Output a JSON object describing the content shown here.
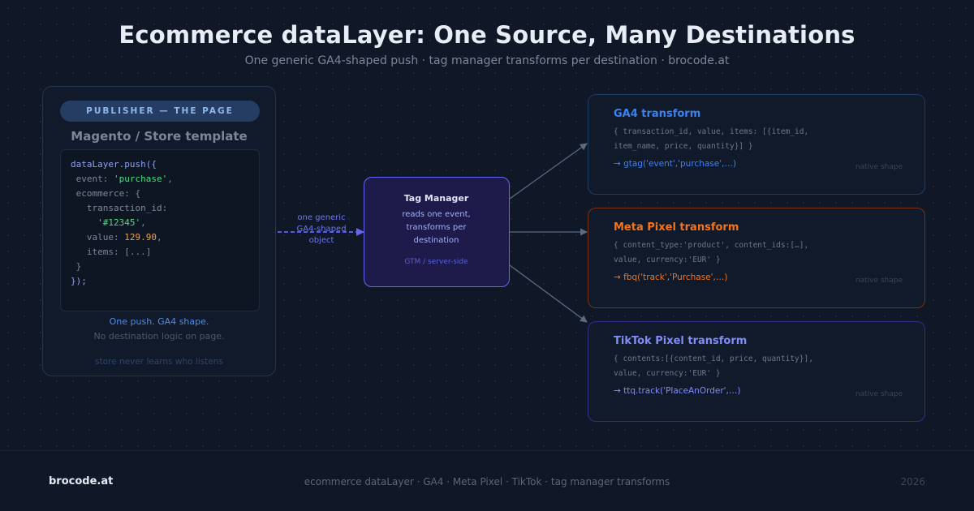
{
  "title": "Ecommerce dataLayer: One Source, Many Destinations",
  "subtitle": "One generic GA4-shaped push · tag manager transforms per destination · brocode.at",
  "publisher": {
    "badge": "PUBLISHER — THE PAGE",
    "subtitle": "Magento / Store template",
    "code": {
      "l1": "dataLayer.push({",
      "l2_key": " event: ",
      "l2_val": "'purchase'",
      "l2_end": ",",
      "l3": " ecommerce: {",
      "l4": "   transaction_id:",
      "l5_pad": "     ",
      "l5_val": "'#12345'",
      "l5_end": ",",
      "l6_key": "   value: ",
      "l6_val": "129.90",
      "l6_end": ",",
      "l7": "   items: [...]",
      "l8": " }",
      "l9": "});"
    },
    "note1": "One push. GA4 shape.",
    "note2": "No destination logic on page.",
    "note3": "store never learns who listens"
  },
  "connector": {
    "line1": "one generic",
    "line2": "GA4-shaped",
    "line3": "object"
  },
  "tag_manager": {
    "title": "Tag Manager",
    "line1": "reads one event,",
    "line2": "transforms per",
    "line3": "destination",
    "footer": "GTM / server-side"
  },
  "destinations": [
    {
      "title": "GA4 transform",
      "code1": "{ transaction_id, value, items: [{item_id,",
      "code2": "item_name, price, quantity}] }",
      "call": "→ gtag('event','purchase',…)",
      "native": "native shape",
      "color": "#3b82f6",
      "border": "#1e3a5f"
    },
    {
      "title": "Meta Pixel transform",
      "code1": "{ content_type:'product', content_ids:[…],",
      "code2": "value, currency:'EUR' }",
      "call": "→ fbq('track','Purchase',…)",
      "native": "native shape",
      "color": "#f97316",
      "border": "#7c2d12"
    },
    {
      "title": "TikTok Pixel transform",
      "code1": "{ contents:[{content_id, price, quantity}],",
      "code2": "value, currency:'EUR' }",
      "call": "→ ttq.track('PlaceAnOrder',…)",
      "native": "native shape",
      "color": "#818cf8",
      "border": "#312e81"
    }
  ],
  "footer": {
    "brand": "brocode.at",
    "center": "ecommerce dataLayer · GA4 · Meta Pixel · TikTok · tag manager transforms",
    "year": "2026"
  }
}
